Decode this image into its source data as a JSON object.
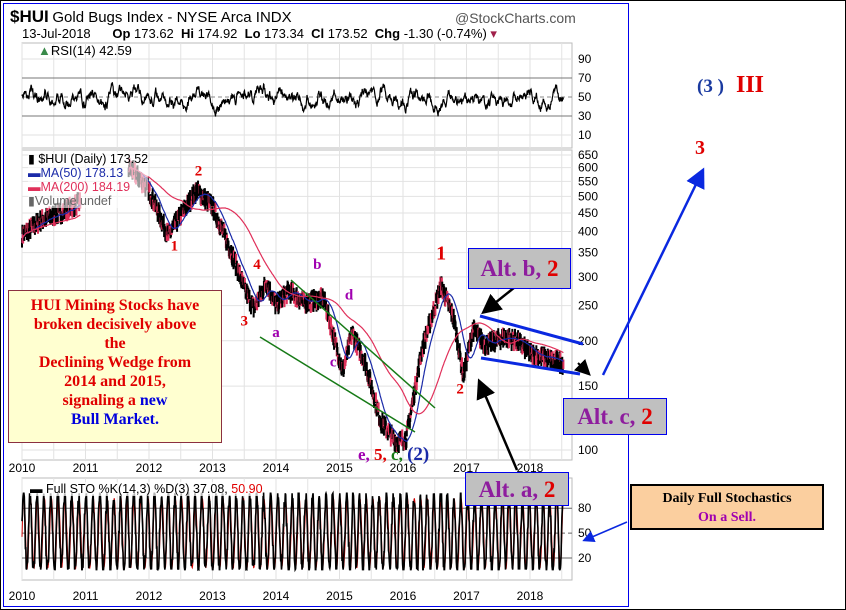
{
  "header": {
    "symbol": "$HUI",
    "name": "Gold Bugs Index - NYSE Arca INDX",
    "source": "@StockCharts.com",
    "date": "13-Jul-2018",
    "op_label": "Op",
    "op": "173.62",
    "hi_label": "Hi",
    "hi": "174.92",
    "lo_label": "Lo",
    "lo": "173.34",
    "cl_label": "Cl",
    "cl": "173.52",
    "chg_label": "Chg",
    "chg": "-1.30 (-0.74%)"
  },
  "rsi": {
    "legend": "RSI(14) 42.59",
    "ticks": [
      "90",
      "70",
      "50",
      "30",
      "10"
    ]
  },
  "price": {
    "legend": "$HUI (Daily) 173.52",
    "ma50": "MA(50) 178.13",
    "ma200": "MA(200) 184.19",
    "volume": "Volume undef",
    "ticks": [
      "650",
      "600",
      "550",
      "500",
      "450",
      "400",
      "350",
      "300",
      "250",
      "200",
      "150",
      "100"
    ]
  },
  "sto": {
    "legend": "Full STO %K(14,3) %D(3) 37.08,",
    "legend_d": "50.90",
    "ticks": [
      "80",
      "50",
      "20"
    ]
  },
  "years": [
    "2010",
    "2011",
    "2012",
    "2013",
    "2014",
    "2015",
    "2016",
    "2017",
    "2018"
  ],
  "colors": {
    "ma50": "#1a2aa8",
    "ma200": "#e0305a",
    "wedge": "#167a16",
    "channel": "#0a28e0"
  },
  "commentary": {
    "l1": "HUI Mining Stocks have",
    "l2": "broken decisively above",
    "l3": "the",
    "l4": "Declining Wedge from",
    "l5": "2014 and 2015,",
    "l6a": "signaling a",
    "l6b": "new",
    "l7": "Bull Market."
  },
  "alt_b": {
    "a": "Alt. b,",
    "b": "2"
  },
  "alt_c": {
    "a": "Alt. c,",
    "b": "2"
  },
  "alt_a": {
    "a": "Alt. a,",
    "b": "2"
  },
  "stoch_box": {
    "l1": "Daily Full Stochastics",
    "l2": "On a Sell."
  },
  "forecast": {
    "p3": "(3 )",
    "iii": "III",
    "w3": "3"
  },
  "chart_data": {
    "type": "line",
    "title": "$HUI Gold Bugs Index - NYSE Arca INDX",
    "yscale": "log",
    "ylim": [
      95,
      650
    ],
    "xlim": [
      2010,
      2018.6
    ],
    "series": [
      {
        "name": "$HUI (Daily)",
        "x": [
          2010.0,
          2010.3,
          2010.6,
          2010.9,
          2011.7,
          2011.85,
          2012.0,
          2012.3,
          2012.45,
          2012.75,
          2013.0,
          2013.3,
          2013.5,
          2013.65,
          2013.85,
          2014.0,
          2014.2,
          2014.45,
          2014.75,
          2015.05,
          2015.2,
          2015.4,
          2015.65,
          2015.9,
          2016.05,
          2016.3,
          2016.6,
          2016.8,
          2016.95,
          2017.1,
          2017.3,
          2017.6,
          2017.8,
          2018.0,
          2018.3,
          2018.53
        ],
        "y": [
          390,
          430,
          450,
          480,
          600,
          560,
          520,
          390,
          430,
          520,
          470,
          350,
          280,
          245,
          290,
          250,
          275,
          255,
          262,
          165,
          210,
          175,
          120,
          105,
          108,
          190,
          285,
          230,
          160,
          215,
          195,
          205,
          200,
          185,
          178,
          173.52
        ]
      }
    ],
    "annotations": [
      {
        "text": "1",
        "x": 2012.4,
        "y": 355,
        "color": "#e00000"
      },
      {
        "text": "2",
        "x": 2012.78,
        "y": 570,
        "color": "#e00000"
      },
      {
        "text": "3",
        "x": 2013.5,
        "y": 220,
        "color": "#e00000"
      },
      {
        "text": "4",
        "x": 2013.7,
        "y": 315,
        "color": "#e00000"
      },
      {
        "text": "a",
        "x": 2014.0,
        "y": 205,
        "color": "#a000b0"
      },
      {
        "text": "b",
        "x": 2014.65,
        "y": 315,
        "color": "#a000b0"
      },
      {
        "text": "c",
        "x": 2014.9,
        "y": 170,
        "color": "#a000b0"
      },
      {
        "text": "d",
        "x": 2015.15,
        "y": 260,
        "color": "#a000b0"
      },
      {
        "text": "1",
        "x": 2016.6,
        "y": 335,
        "color": "#e00000"
      },
      {
        "text": "2",
        "x": 2016.9,
        "y": 143,
        "color": "#e00000"
      }
    ],
    "bottom_label": [
      {
        "text": "e,",
        "color": "#a000b0"
      },
      {
        "text": "5,",
        "color": "#e00000"
      },
      {
        "text": "c,",
        "color": "#167a16"
      },
      {
        "text": "(2)",
        "color": "#1a2aa8"
      }
    ],
    "rsi_last": 42.59,
    "sto_k_last": 37.08,
    "sto_d_last": 50.9
  }
}
